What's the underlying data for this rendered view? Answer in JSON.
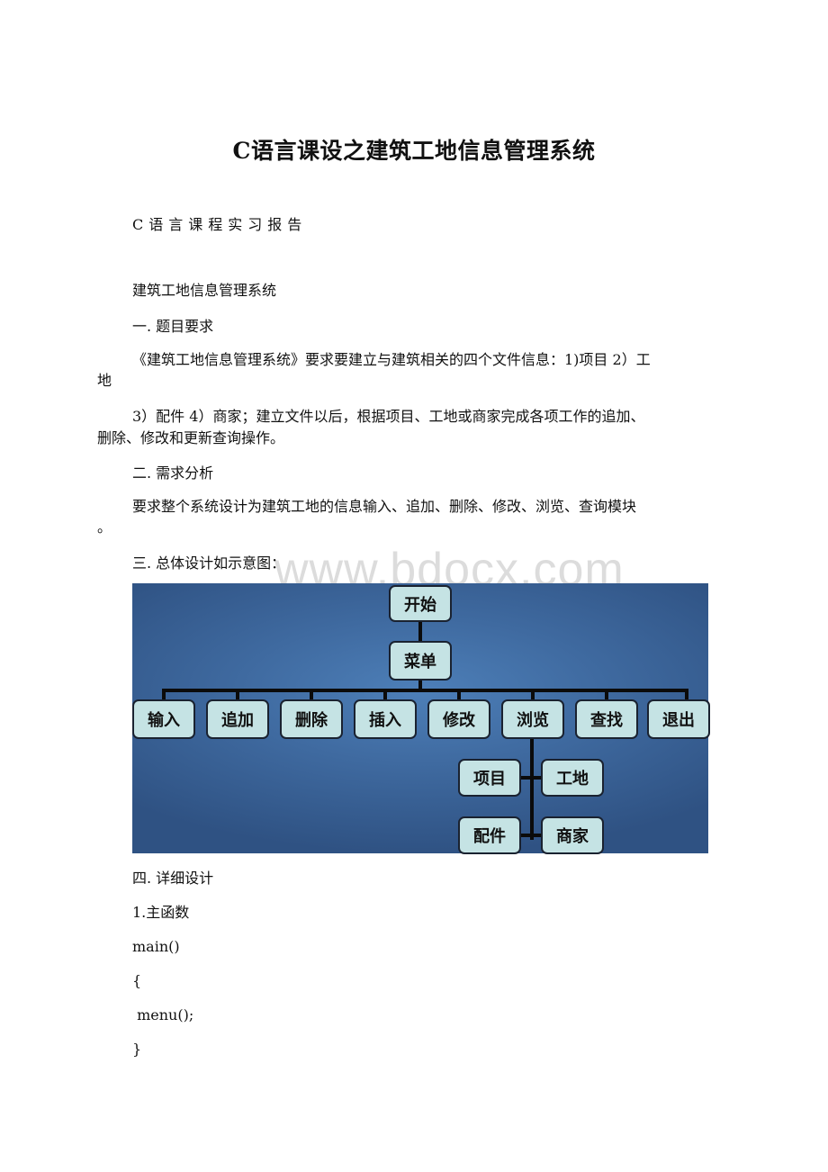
{
  "document": {
    "title": "C语言课设之建筑工地信息管理系统",
    "subtitle": "C语言课程实习报告",
    "system_name": "建筑工地信息管理系统",
    "section1": {
      "heading": "一. 题目要求",
      "line1": "《建筑工地信息管理系统》要求要建立与建筑相关的四个文件信息：1)项目 2）工",
      "line1_wrap": "地",
      "line2": "3）配件 4）商家；建立文件以后，根据项目、工地或商家完成各项工作的追加、",
      "line2_wrap": "删除、修改和更新查询操作。"
    },
    "section2": {
      "heading": "二. 需求分析",
      "line1": " 要求整个系统设计为建筑工地的信息输入、追加、删除、修改、浏览、查询模块",
      "line1_wrap": "。"
    },
    "section3": {
      "heading": "三. 总体设计如示意图："
    },
    "diagram": {
      "root": "开始",
      "menu": "菜单",
      "menu_items": [
        "输入",
        "追加",
        "删除",
        "插入",
        "修改",
        "浏览",
        "查找",
        "退出"
      ],
      "browse_children": [
        "项目",
        "工地",
        "配件",
        "商家"
      ]
    },
    "section4": {
      "heading": "四. 详细设计",
      "sub1": "1.主函数",
      "code": [
        "main()",
        "{",
        " menu();",
        "}"
      ]
    }
  },
  "watermark": "www.bdocx.com"
}
